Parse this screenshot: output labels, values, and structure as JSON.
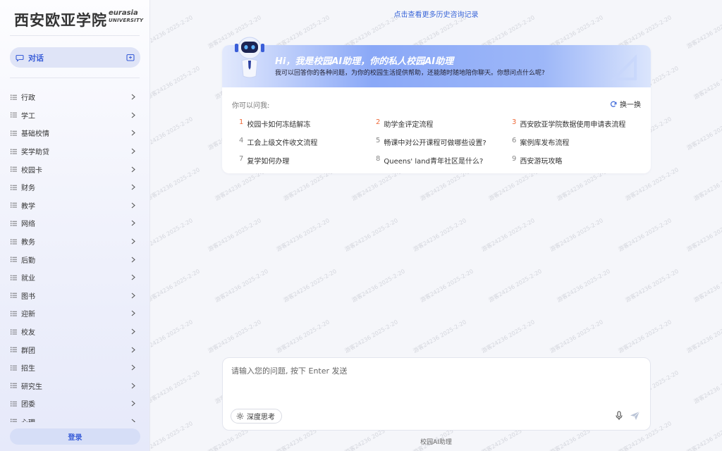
{
  "sidebar": {
    "logo_cn": "西安欧亚学院",
    "logo_en_1": "eurasia",
    "logo_en_2": "UNIVERSITY",
    "chat_label": "对话",
    "menu": [
      "行政",
      "学工",
      "基础校情",
      "奖学助贷",
      "校园卡",
      "财务",
      "教学",
      "网络",
      "教务",
      "后勤",
      "就业",
      "图书",
      "迎新",
      "校友",
      "群团",
      "招生",
      "研究生",
      "团委",
      "心理"
    ],
    "login_label": "登录"
  },
  "main": {
    "history_link": "点击查看更多历史咨询记录",
    "welcome": {
      "greeting": "Hi，我是校园AI助理，你的私人校园AI助理",
      "intro": "我可以回答你的各种问题，为你的校园生活提供帮助，还能随时随地陪你聊天。你想问点什么呢?",
      "can_ask": "你可以问我:",
      "refresh_label": "换一换",
      "questions": [
        {
          "n": "1",
          "text": "校园卡如何冻结解冻"
        },
        {
          "n": "2",
          "text": "助学金评定流程"
        },
        {
          "n": "3",
          "text": "西安欧亚学院数据使用申请表流程"
        },
        {
          "n": "4",
          "text": "工会上级文件收文流程"
        },
        {
          "n": "5",
          "text": "畅课中对公开课程可做哪些设置?"
        },
        {
          "n": "6",
          "text": "案例库发布流程"
        },
        {
          "n": "7",
          "text": "复学如何办理"
        },
        {
          "n": "8",
          "text": "Queens' land青年社区是什么?"
        },
        {
          "n": "9",
          "text": "西安游玩攻略"
        }
      ]
    },
    "input": {
      "placeholder": "请输入您的问题, 按下 Enter 发送",
      "deep_think_label": "深度思考"
    },
    "footer": "校园AI助理",
    "watermark": "游客24236  2025-2-20"
  },
  "colors": {
    "accent": "#3a5ed8",
    "hot_number": "#ef6a3a"
  }
}
